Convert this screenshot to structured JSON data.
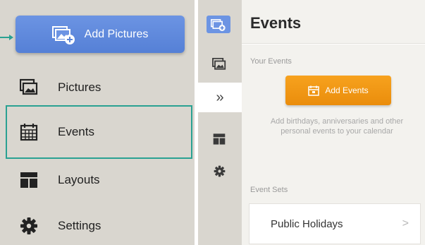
{
  "sidebar": {
    "add_button_label": "Add Pictures",
    "items": [
      {
        "label": "Pictures",
        "icon": "pictures-icon"
      },
      {
        "label": "Events",
        "icon": "calendar-icon",
        "selected": true
      },
      {
        "label": "Layouts",
        "icon": "layouts-icon"
      },
      {
        "label": "Settings",
        "icon": "gear-icon"
      }
    ]
  },
  "rail": {
    "expand_glyph": "»"
  },
  "events_panel": {
    "title": "Events",
    "your_events_label": "Your Events",
    "add_events_label": "Add Events",
    "hint": "Add birthdays, anniversaries and other personal events to your calendar",
    "event_sets_label": "Event Sets",
    "event_sets": [
      {
        "label": "Public Holidays",
        "chevron": ">"
      }
    ]
  },
  "colors": {
    "accent_teal": "#2aa192",
    "add_pictures_blue": "#6c94e3",
    "add_events_orange": "#f39a17",
    "panel_gray": "#d9d6cf"
  }
}
